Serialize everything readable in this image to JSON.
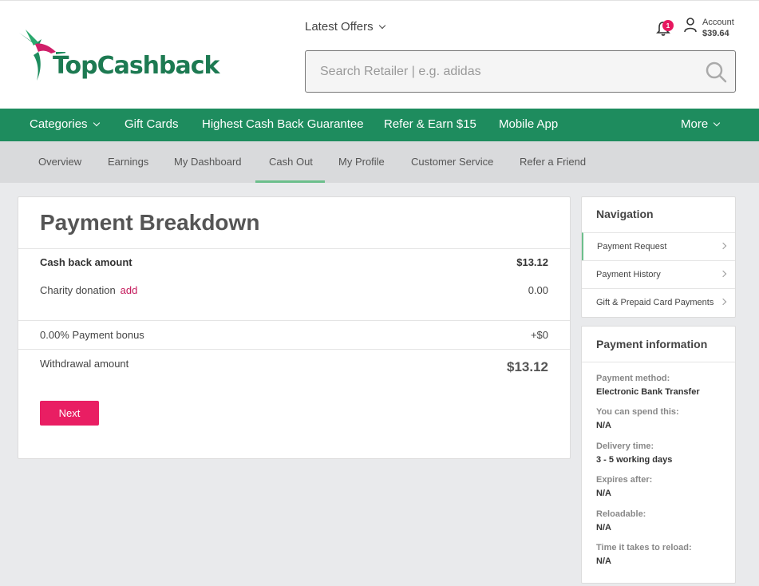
{
  "header": {
    "logo_text": "TopCashback",
    "latest_offers_label": "Latest Offers",
    "search_placeholder": "Search Retailer | e.g. adidas",
    "notification_count": "1",
    "account_label": "Account",
    "account_balance": "$39.64"
  },
  "topnav": {
    "items": [
      "Categories",
      "Gift Cards",
      "Highest Cash Back Guarantee",
      "Refer & Earn $15",
      "Mobile App",
      "More"
    ]
  },
  "subnav": {
    "items": [
      "Overview",
      "Earnings",
      "My Dashboard",
      "Cash Out",
      "My Profile",
      "Customer Service",
      "Refer a Friend"
    ],
    "active": "Cash Out"
  },
  "breakdown": {
    "title": "Payment Breakdown",
    "cashback_label": "Cash back amount",
    "cashback_value": "$13.12",
    "charity_label": "Charity donation",
    "charity_add": "add",
    "charity_value": "0.00",
    "bonus_label": "0.00% Payment bonus",
    "bonus_value": "+$0",
    "withdrawal_label": "Withdrawal amount",
    "withdrawal_value": "$13.12",
    "next_label": "Next"
  },
  "navigation": {
    "title": "Navigation",
    "items": [
      "Payment Request",
      "Payment History",
      "Gift & Prepaid Card Payments"
    ]
  },
  "payment_info": {
    "title": "Payment information",
    "fields": [
      {
        "label": "Payment method:",
        "value": "Electronic Bank Transfer"
      },
      {
        "label": "You can spend this:",
        "value": "N/A"
      },
      {
        "label": "Delivery time:",
        "value": "3 - 5 working days"
      },
      {
        "label": "Expires after:",
        "value": "N/A"
      },
      {
        "label": "Reloadable:",
        "value": "N/A"
      },
      {
        "label": "Time it takes to reload:",
        "value": "N/A"
      }
    ]
  },
  "colors": {
    "brand_green": "#1e8c5e",
    "accent_pink": "#e91e63",
    "link_pink": "#c4185a"
  }
}
